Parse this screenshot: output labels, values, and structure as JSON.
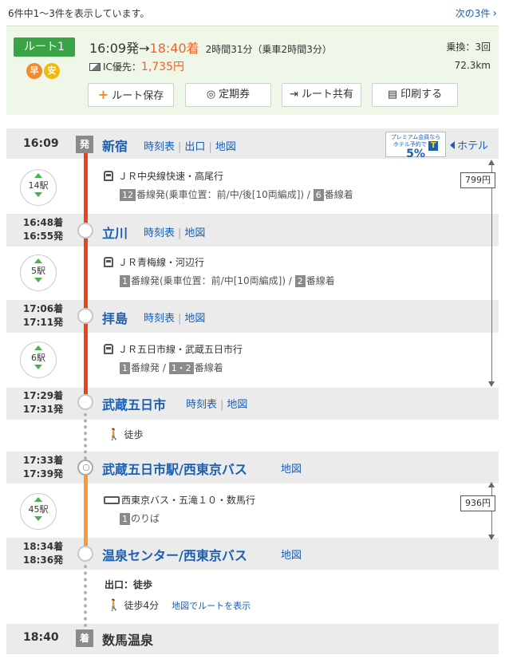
{
  "header": {
    "count_text": "6件中1〜3件を表示しています。",
    "next_label": "次の3件"
  },
  "route": {
    "label": "ルート1",
    "badges": [
      "早",
      "安"
    ],
    "dep_time": "16:09発",
    "arrow": "→",
    "arr_time": "18:40着",
    "duration": "2時間31分（乗車2時間3分）",
    "ic_label": "IC優先：",
    "fare": "1,735円",
    "transfers": "乗換：3回",
    "distance": "72.3km",
    "buttons": {
      "save": "ルート保存",
      "pass": "定期券",
      "share": "ルート共有",
      "print": "印刷する"
    }
  },
  "hotel": {
    "banner_line1": "プレミアム会員なら",
    "banner_line2": "ホテル予約で",
    "banner_pct": "5%",
    "banner_t": "T",
    "link": "ホテル"
  },
  "stations": [
    {
      "name": "新宿",
      "time": "16:09",
      "mark": "発",
      "links": [
        "時刻表",
        "出口",
        "地図"
      ]
    },
    {
      "name": "立川",
      "arr": "16:48着",
      "dep": "16:55発",
      "links": [
        "時刻表",
        "地図"
      ]
    },
    {
      "name": "拝島",
      "arr": "17:06着",
      "dep": "17:11発",
      "links": [
        "時刻表",
        "地図"
      ]
    },
    {
      "name": "武蔵五日市",
      "arr": "17:29着",
      "dep": "17:31発",
      "links": [
        "時刻表",
        "地図"
      ]
    },
    {
      "name": "武蔵五日市駅/西東京バス",
      "arr": "17:33着",
      "dep": "17:39発",
      "links": [
        "地図"
      ]
    },
    {
      "name": "温泉センター/西東京バス",
      "arr": "18:34着",
      "dep": "18:36発",
      "links": [
        "地図"
      ]
    },
    {
      "name": "数馬温泉",
      "time": "18:40",
      "mark": "着"
    }
  ],
  "segments": [
    {
      "stops": "14駅",
      "line": "ＪＲ中央線快速・高尾行",
      "plat1": "12",
      "plat1_text": "番線発(乗車位置：前/中/後[10両編成])",
      "sep": " / ",
      "plat2": "6",
      "plat2_text": "番線着"
    },
    {
      "stops": "5駅",
      "line": "ＪＲ青梅線・河辺行",
      "plat1": "1",
      "plat1_text": "番線発(乗車位置：前/中[10両編成])",
      "sep": " / ",
      "plat2": "2",
      "plat2_text": "番線着"
    },
    {
      "stops": "6駅",
      "line": "ＪＲ五日市線・武蔵五日市行",
      "plat1": "1",
      "plat1_text": "番線発",
      "sep": " / ",
      "plat2": "1・2",
      "plat2_text": "番線着"
    },
    {
      "walk": "徒歩"
    },
    {
      "stops": "45駅",
      "line": "西東京バス・五滝１０・数馬行",
      "plat1": "1",
      "plat1_text": "のりば"
    }
  ],
  "fares": {
    "rail": "799円",
    "bus": "936円"
  },
  "final_walk": {
    "exit": "出口：徒歩",
    "walk": "徒歩4分",
    "map_link": "地図でルートを表示"
  },
  "colors": {
    "rail_line": "#e8441d",
    "bus_line": "#f39a3b",
    "link": "#1a5fb4",
    "accent": "#f0632b",
    "route_badge": "#3aa346"
  }
}
